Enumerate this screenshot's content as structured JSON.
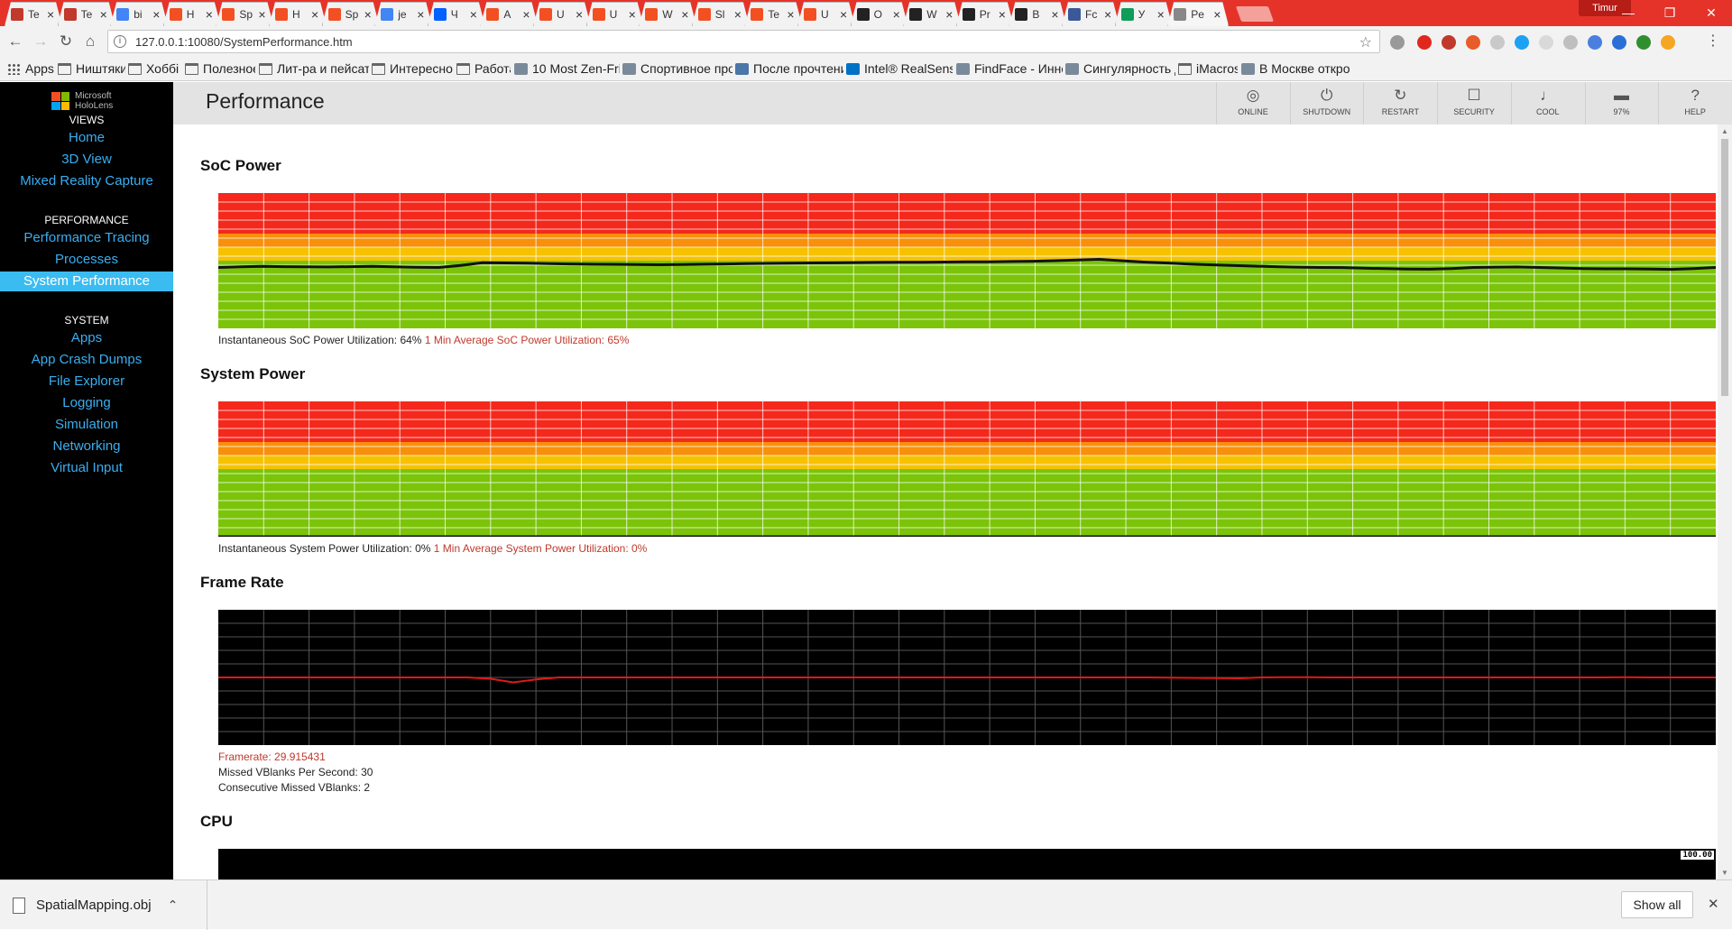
{
  "browser": {
    "tabs": [
      {
        "title": "Te",
        "favicon": "oculus-icon",
        "color": "#c0392b"
      },
      {
        "title": "Te",
        "favicon": "oculus-icon",
        "color": "#c0392b"
      },
      {
        "title": "bi",
        "favicon": "google-icon",
        "color": "#4285f4"
      },
      {
        "title": "H",
        "favicon": "microsoft-icon",
        "color": "#f25022"
      },
      {
        "title": "Sp",
        "favicon": "microsoft-icon",
        "color": "#f25022"
      },
      {
        "title": "H",
        "favicon": "microsoft-icon",
        "color": "#f25022"
      },
      {
        "title": "Sp",
        "favicon": "microsoft-icon",
        "color": "#f25022"
      },
      {
        "title": "je",
        "favicon": "google-icon",
        "color": "#4285f4"
      },
      {
        "title": "Ч",
        "favicon": "dropbox-icon",
        "color": "#0061ff"
      },
      {
        "title": "A",
        "favicon": "microsoft-icon",
        "color": "#f25022"
      },
      {
        "title": "U",
        "favicon": "microsoft-icon",
        "color": "#f25022"
      },
      {
        "title": "U",
        "favicon": "microsoft-icon",
        "color": "#f25022"
      },
      {
        "title": "W",
        "favicon": "microsoft-icon",
        "color": "#f25022"
      },
      {
        "title": "Sl",
        "favicon": "microsoft-icon",
        "color": "#f25022"
      },
      {
        "title": "Te",
        "favicon": "microsoft-icon",
        "color": "#f25022"
      },
      {
        "title": "U",
        "favicon": "microsoft-icon",
        "color": "#f25022"
      },
      {
        "title": "O",
        "favicon": "m-icon",
        "color": "#222222"
      },
      {
        "title": "W",
        "favicon": "m-icon",
        "color": "#222222"
      },
      {
        "title": "Pr",
        "favicon": "m-icon",
        "color": "#222222"
      },
      {
        "title": "B",
        "favicon": "m-icon",
        "color": "#222222"
      },
      {
        "title": "Fc",
        "favicon": "facebook-icon",
        "color": "#3b5998"
      },
      {
        "title": "У",
        "favicon": "sheet-icon",
        "color": "#0f9d58"
      },
      {
        "title": "Pe",
        "favicon": "page-icon",
        "color": "#888888"
      }
    ],
    "profile_name": "Timur",
    "url": "127.0.0.1:10080/SystemPerformance.htm",
    "bookmarks": [
      {
        "label": "Apps",
        "icon": "apps-icon"
      },
      {
        "label": "Ништяки",
        "icon": "folder-icon"
      },
      {
        "label": "Хоббі",
        "icon": "folder-icon"
      },
      {
        "label": "Полезное",
        "icon": "folder-icon"
      },
      {
        "label": "Лит-ра и пейсате",
        "icon": "folder-icon"
      },
      {
        "label": "Интересное",
        "icon": "folder-icon"
      },
      {
        "label": "Работа",
        "icon": "folder-icon"
      },
      {
        "label": "10 Most Zen-Frie",
        "icon": "site-icon"
      },
      {
        "label": "Спортивное про",
        "icon": "site-icon"
      },
      {
        "label": "После прочтени",
        "icon": "vk-icon"
      },
      {
        "label": "Intel® RealSense",
        "icon": "intel-icon"
      },
      {
        "label": "FindFace - Иннов",
        "icon": "site-icon"
      },
      {
        "label": "Сингулярность д",
        "icon": "site-icon"
      },
      {
        "label": "iMacros",
        "icon": "folder-icon"
      },
      {
        "label": "В Москве откро",
        "icon": "site-icon"
      }
    ]
  },
  "brand": {
    "line1": "Microsoft",
    "line2": "HoloLens"
  },
  "sidebar": {
    "sections": [
      {
        "heading": "VIEWS",
        "items": [
          "Home",
          "3D View",
          "Mixed Reality Capture"
        ]
      },
      {
        "heading": "PERFORMANCE",
        "items": [
          "Performance Tracing",
          "Processes",
          "System Performance"
        ]
      },
      {
        "heading": "SYSTEM",
        "items": [
          "Apps",
          "App Crash Dumps",
          "File Explorer",
          "Logging",
          "Simulation",
          "Networking",
          "Virtual Input"
        ]
      }
    ],
    "active": "System Performance"
  },
  "header": {
    "title": "Performance",
    "buttons": [
      {
        "label": "ONLINE",
        "icon": "wifi-icon"
      },
      {
        "label": "SHUTDOWN",
        "icon": "power-icon"
      },
      {
        "label": "RESTART",
        "icon": "restart-icon"
      },
      {
        "label": "SECURITY",
        "icon": "lock-icon"
      },
      {
        "label": "COOL",
        "icon": "thermometer-icon"
      },
      {
        "label": "97%",
        "icon": "battery-icon"
      },
      {
        "label": "HELP",
        "icon": "help-icon"
      }
    ]
  },
  "sections": {
    "soc": {
      "title": "SoC Power",
      "instant": "Instantaneous SoC Power Utilization: 64%",
      "average": "1 Min Average SoC Power Utilization: 65%"
    },
    "system": {
      "title": "System Power",
      "instant": "Instantaneous System Power Utilization: 0%",
      "average": "1 Min Average System Power Utilization: 0%"
    },
    "framerate": {
      "title": "Frame Rate",
      "framerate": "Framerate: 29.915431",
      "missed": "Missed VBlanks Per Second: 30",
      "consecutive": "Consecutive Missed VBlanks: 2"
    },
    "cpu": {
      "title": "CPU",
      "max_label": "100.00"
    }
  },
  "chart_data": [
    {
      "type": "line",
      "name": "soc-power-chart",
      "x": [
        0,
        1,
        2,
        3,
        4,
        5,
        6,
        7,
        8,
        9,
        10,
        11,
        12,
        13,
        14,
        15,
        16,
        17,
        18,
        19,
        20,
        21,
        22,
        23,
        24,
        25,
        26,
        27,
        28,
        29,
        30,
        31,
        32,
        33,
        34,
        35,
        36,
        37,
        38,
        39,
        40,
        41,
        42,
        43,
        44,
        45,
        46,
        47,
        48,
        49,
        50,
        51,
        52,
        53,
        54,
        55,
        56,
        57,
        58,
        59,
        60,
        61,
        62,
        63,
        64,
        65,
        66
      ],
      "series": [
        {
          "values": [
            45,
            45.5,
            45.8,
            45.6,
            45.5,
            45.4,
            45.6,
            45.8,
            45.5,
            45.2,
            45,
            46.5,
            48.5,
            48.3,
            48.1,
            47.8,
            47.6,
            47.4,
            47.3,
            47.1,
            47,
            47.2,
            47.4,
            47.6,
            47.8,
            48,
            48.1,
            48.3,
            48.4,
            48.6,
            48.7,
            48.8,
            48.9,
            49,
            49.1,
            49.2,
            49.4,
            49.6,
            50,
            50.5,
            51,
            50,
            49,
            48.3,
            47.6,
            47,
            46.5,
            46,
            45.6,
            45.3,
            45,
            44.9,
            44.5,
            44.1,
            43.8,
            43.7,
            44.2,
            45,
            45.3,
            45.4,
            45,
            44.6,
            44.1,
            44,
            44,
            43.8,
            43.6,
            44.2,
            45
          ]
        }
      ],
      "ylim": [
        0,
        100
      ],
      "bands": [
        {
          "from": 70,
          "to": 100,
          "color": "#f5281c"
        },
        {
          "from": 60,
          "to": 70,
          "color": "#f8900c"
        },
        {
          "from": 50,
          "to": 60,
          "color": "#f6c200"
        },
        {
          "from": 0,
          "to": 50,
          "color": "#7bc40a"
        }
      ],
      "line_color": "#111111"
    },
    {
      "type": "line",
      "name": "system-power-chart",
      "series": [
        {
          "values": [
            0,
            0
          ]
        }
      ],
      "ylim": [
        0,
        100
      ],
      "bands": [
        {
          "from": 70,
          "to": 100,
          "color": "#f5281c"
        },
        {
          "from": 60,
          "to": 70,
          "color": "#f8900c"
        },
        {
          "from": 50,
          "to": 60,
          "color": "#f6c200"
        },
        {
          "from": 0,
          "to": 50,
          "color": "#7bc40a"
        }
      ],
      "line_color": "#111111"
    },
    {
      "type": "line",
      "name": "frame-rate-chart",
      "series": [
        {
          "values": [
            30,
            30,
            30,
            30,
            30,
            30,
            30,
            30,
            30,
            30,
            30,
            30,
            29.4,
            27.8,
            29.1,
            30,
            30,
            30,
            30,
            30,
            30,
            30,
            30,
            30,
            30,
            30,
            30,
            30,
            30,
            30,
            30,
            30,
            30,
            30,
            30,
            30,
            30,
            30,
            30,
            30,
            30,
            30,
            29.9,
            29.8,
            29.7,
            29.6,
            30,
            30.1,
            30.1,
            30,
            30,
            30,
            30,
            30,
            30,
            30,
            30,
            30,
            30,
            30,
            30,
            30,
            30.1,
            30,
            30,
            30,
            30
          ]
        }
      ],
      "ylim": [
        0,
        60
      ],
      "line_color": "#e01818",
      "background": "#000000"
    }
  ]
}
